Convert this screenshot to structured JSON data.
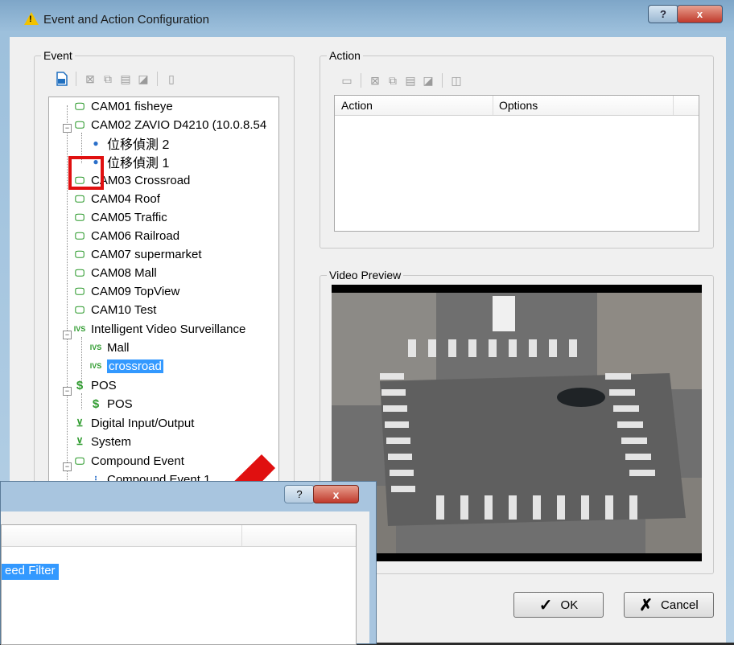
{
  "window": {
    "title": "Event and Action Configuration",
    "help_label": "?",
    "close_label": "x"
  },
  "event_group": {
    "label": "Event",
    "tree": [
      {
        "label": "CAM01 fisheye"
      },
      {
        "label": "CAM02 ZAVIO D4210 (10.0.8.54"
      },
      {
        "label": "位移偵測 2"
      },
      {
        "label": "位移偵測 1"
      },
      {
        "label": "CAM03 Crossroad"
      },
      {
        "label": "CAM04 Roof"
      },
      {
        "label": "CAM05 Traffic"
      },
      {
        "label": "CAM06 Railroad"
      },
      {
        "label": "CAM07 supermarket"
      },
      {
        "label": "CAM08 Mall"
      },
      {
        "label": "CAM09 TopView"
      },
      {
        "label": "CAM10 Test"
      },
      {
        "label": "Intelligent Video Surveillance"
      },
      {
        "label": "Mall"
      },
      {
        "label": "crossroad"
      },
      {
        "label": "POS"
      },
      {
        "label": "POS"
      },
      {
        "label": "Digital Input/Output"
      },
      {
        "label": "System"
      },
      {
        "label": "Compound Event"
      },
      {
        "label": "Compound Event 1"
      }
    ],
    "icon_texts": {
      "ivs": "IVS",
      "pos": "$"
    }
  },
  "action_group": {
    "label": "Action",
    "columns": [
      "Action",
      "Options"
    ]
  },
  "preview_group": {
    "label": "Video Preview"
  },
  "buttons": {
    "ok": "OK",
    "cancel": "Cancel",
    "ok_glyph": "✓",
    "cancel_glyph": "✗"
  },
  "sub_dialog": {
    "help_label": "?",
    "close_label": "x",
    "selected_item": "eed Filter"
  }
}
